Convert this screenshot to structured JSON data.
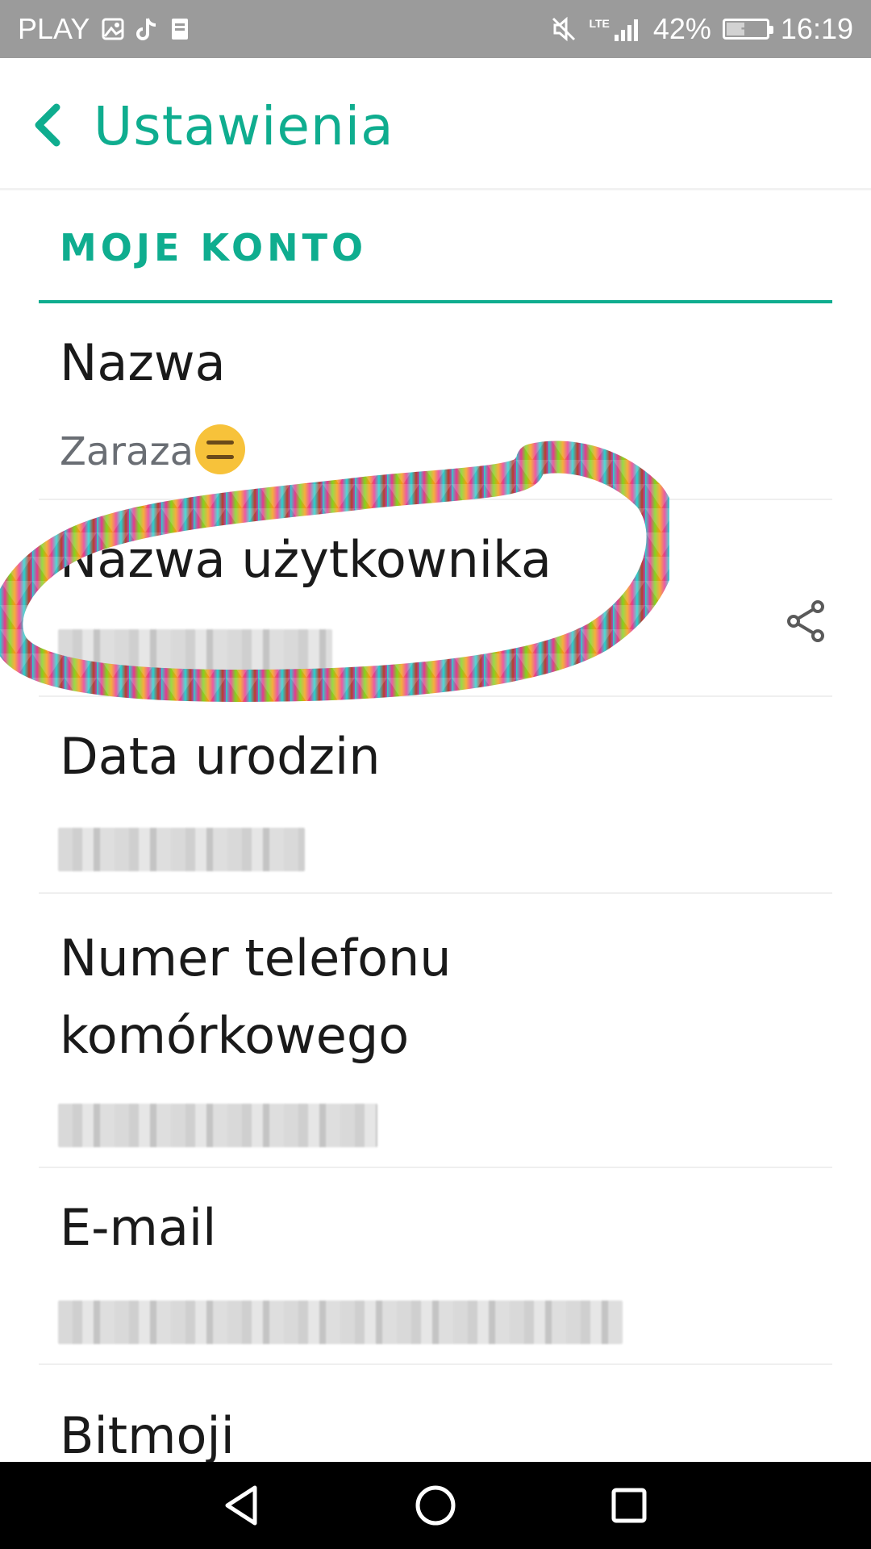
{
  "status_bar": {
    "carrier": "PLAY",
    "left_icons": [
      "gallery-icon",
      "tiktok-icon",
      "storage-icon"
    ],
    "right_icons": [
      "mute-icon",
      "lte-signal-icon",
      "battery-charging-icon"
    ],
    "network_label": "LTE",
    "battery_percent": "42%",
    "time": "16:19"
  },
  "header": {
    "title": "Ustawienia"
  },
  "section": {
    "title": "MOJE KONTO"
  },
  "rows": {
    "name": {
      "title": "Nazwa",
      "value": "Zaraza"
    },
    "username": {
      "title": "Nazwa użytkownika"
    },
    "birthdate": {
      "title": "Data urodzin"
    },
    "phone": {
      "title_line1": "Numer telefonu",
      "title_line2": "komórkowego"
    },
    "email": {
      "title": "E-mail"
    },
    "bitmoji": {
      "title": "Bitmoji"
    }
  },
  "accent_color": "#0fad8f",
  "navigation": [
    "back-triangle-icon",
    "home-circle-icon",
    "recents-square-icon"
  ]
}
